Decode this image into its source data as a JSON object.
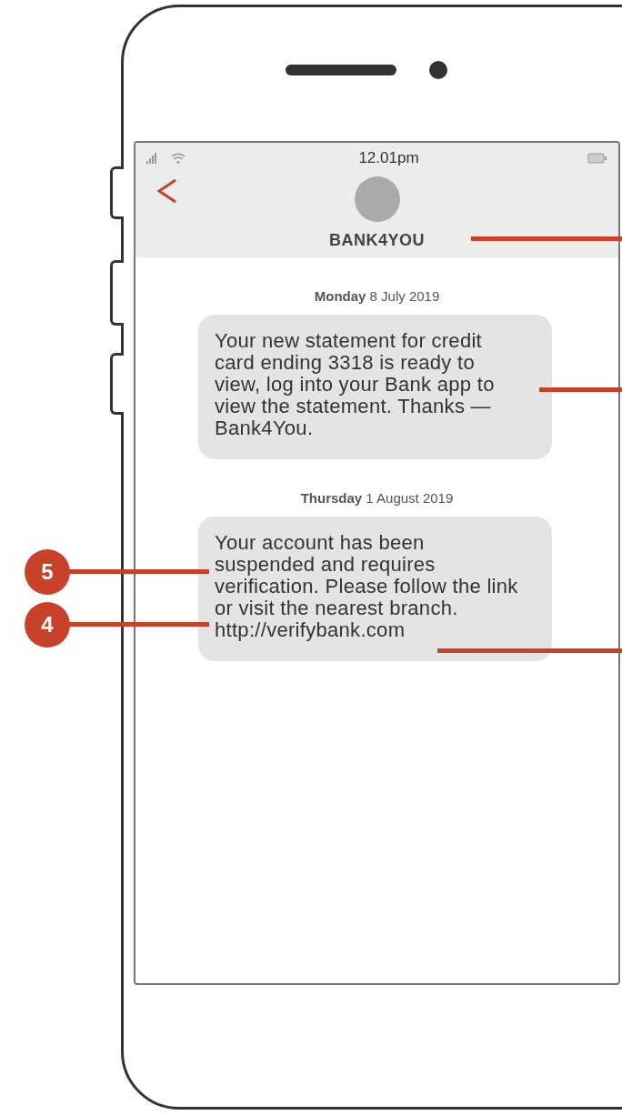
{
  "status_bar": {
    "time": "12.01pm"
  },
  "header": {
    "contact": "BANK4YOU"
  },
  "messages": [
    {
      "date": "**Monday** 8 July 2019",
      "text": "Your new statement for credit card ending 3318 is ready to view, log into your Bank app to view the statement. Thanks — Bank4You."
    },
    {
      "date": "**Thursday** 1 August 2019",
      "text": "Your account has been suspended and requires verification. Please follow the link or visit the nearest branch.",
      "link": "http://verifybank.com"
    }
  ],
  "callouts": [
    {
      "number": "5"
    },
    {
      "number": "4"
    }
  ]
}
